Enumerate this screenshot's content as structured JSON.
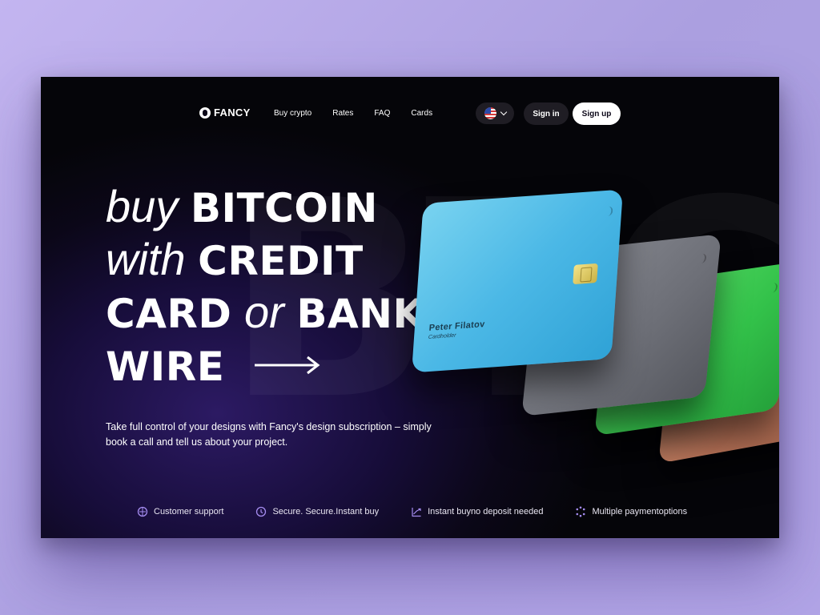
{
  "brand": {
    "name": "FANCY"
  },
  "nav": {
    "links": [
      "Buy crypto",
      "Rates",
      "FAQ",
      "Cards"
    ],
    "sign_in": "Sign in",
    "sign_up": "Sign up",
    "language_icon": "us-flag-icon"
  },
  "hero": {
    "line1_light": "buy",
    "line1_bold": "BITCOIN",
    "line2_light": "with",
    "line2_bold": "CREDIT",
    "line3_bold_a": "CARD",
    "line3_light": "or",
    "line3_bold_b": "BANK",
    "line4_bold": "WIRE",
    "description": "Take full control of your designs with Fancy's design subscription – simply book a call and tell us about your project.",
    "background_text": "BTC"
  },
  "card": {
    "name": "Peter Filatov",
    "holder_label": "Cardholder"
  },
  "features": [
    {
      "icon": "support-icon",
      "label": "Customer support"
    },
    {
      "icon": "clock-icon",
      "label": "Secure. Secure.Instant buy"
    },
    {
      "icon": "trend-icon",
      "label": "Instant buyno deposit needed"
    },
    {
      "icon": "payment-icon",
      "label": "Multiple paymentoptions"
    }
  ],
  "colors": {
    "background": "#b6a8ea",
    "panel": "#0b0718",
    "accent": "#a58cf0",
    "card_blue": "#4bb8e6",
    "card_grey": "#6d6f77",
    "card_green": "#33c24a",
    "card_copper": "#b97358"
  }
}
